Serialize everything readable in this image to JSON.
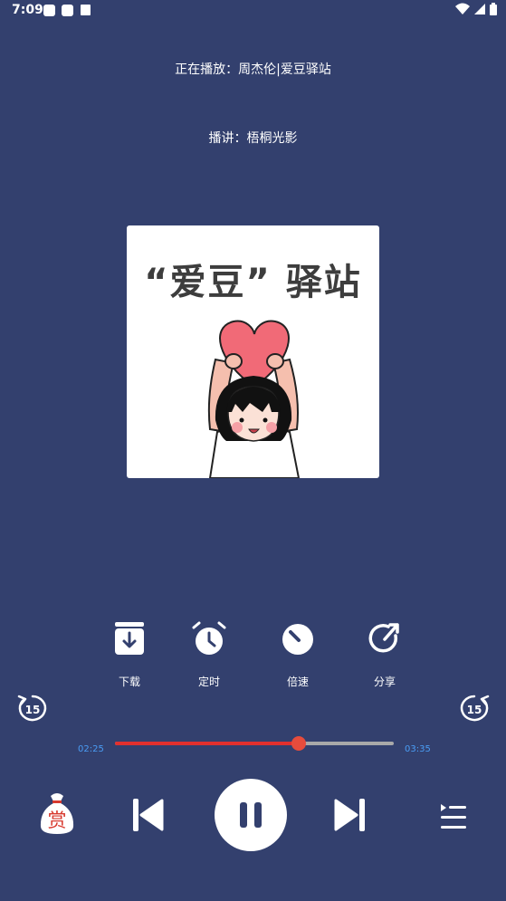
{
  "status_bar": {
    "time": "7:09"
  },
  "header": {
    "now_playing_label": "正在播放：",
    "now_playing_title": "周杰伦|爱豆驿站",
    "narrator_label": "播讲：",
    "narrator_name": "梧桐光影"
  },
  "cover": {
    "title": "“爱豆” 驿站"
  },
  "functions": {
    "download": "下载",
    "timer": "定时",
    "speed": "倍速",
    "share": "分享"
  },
  "skip": {
    "back_seconds": "15",
    "forward_seconds": "15"
  },
  "progress": {
    "current": "02:25",
    "total": "03:35",
    "fraction": 0.66
  },
  "colors": {
    "background": "#33406e",
    "progress_played": "#e2302e",
    "progress_remaining": "#a9a9a9",
    "time_text": "#4a9cf4"
  },
  "controls": {
    "reward_label": "赏"
  }
}
